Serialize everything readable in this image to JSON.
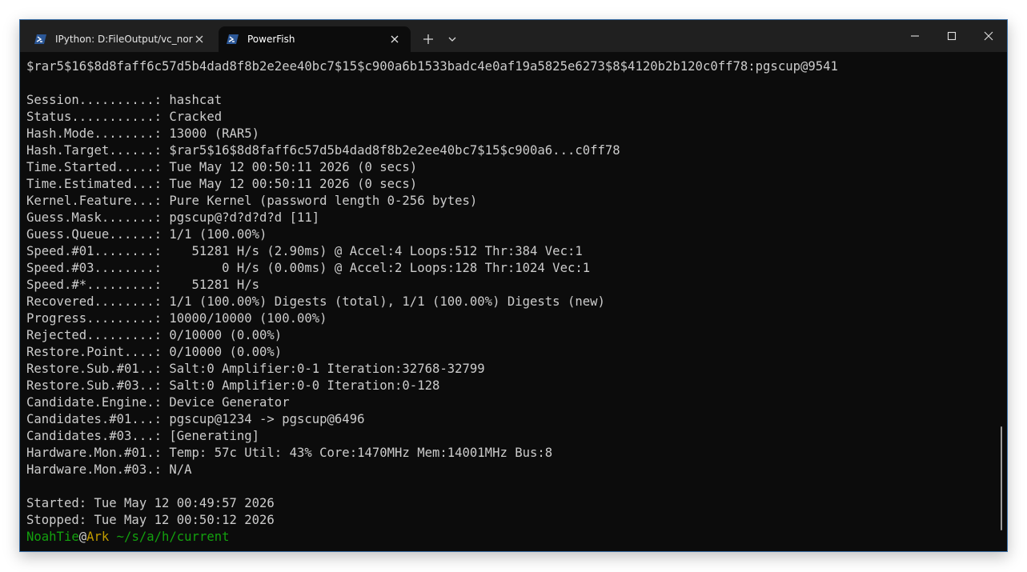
{
  "tabs": [
    {
      "label": "IPython: D:FileOutput/vc_norm",
      "icon": "powershell-icon",
      "active": false
    },
    {
      "label": "PowerFish",
      "icon": "powershell-icon",
      "active": true
    }
  ],
  "controls": {
    "new_tab_icon": "plus-icon",
    "dropdown_icon": "chevron-down-icon",
    "minimize_icon": "minimize-icon",
    "maximize_icon": "maximize-icon",
    "close_icon": "close-icon"
  },
  "terminal": {
    "lines": [
      "$rar5$16$8d8faff6c57d5b4dad8f8b2e2ee40bc7$15$c900a6b1533badc4e0af19a5825e6273$8$4120b2b120c0ff78:pgscup@9541",
      "",
      "Session..........: hashcat",
      "Status...........: Cracked",
      "Hash.Mode........: 13000 (RAR5)",
      "Hash.Target......: $rar5$16$8d8faff6c57d5b4dad8f8b2e2ee40bc7$15$c900a6...c0ff78",
      "Time.Started.....: Tue May 12 00:50:11 2026 (0 secs)",
      "Time.Estimated...: Tue May 12 00:50:11 2026 (0 secs)",
      "Kernel.Feature...: Pure Kernel (password length 0-256 bytes)",
      "Guess.Mask.......: pgscup@?d?d?d?d [11]",
      "Guess.Queue......: 1/1 (100.00%)",
      "Speed.#01........:    51281 H/s (2.90ms) @ Accel:4 Loops:512 Thr:384 Vec:1",
      "Speed.#03........:        0 H/s (0.00ms) @ Accel:2 Loops:128 Thr:1024 Vec:1",
      "Speed.#*.........:    51281 H/s",
      "Recovered........: 1/1 (100.00%) Digests (total), 1/1 (100.00%) Digests (new)",
      "Progress.........: 10000/10000 (100.00%)",
      "Rejected.........: 0/10000 (0.00%)",
      "Restore.Point....: 0/10000 (0.00%)",
      "Restore.Sub.#01..: Salt:0 Amplifier:0-1 Iteration:32768-32799",
      "Restore.Sub.#03..: Salt:0 Amplifier:0-0 Iteration:0-128",
      "Candidate.Engine.: Device Generator",
      "Candidates.#01...: pgscup@1234 -> pgscup@6496",
      "Candidates.#03...: [Generating]",
      "Hardware.Mon.#01.: Temp: 57c Util: 43% Core:1470MHz Mem:14001MHz Bus:8",
      "Hardware.Mon.#03.: N/A",
      "",
      "Started: Tue May 12 00:49:57 2026",
      "Stopped: Tue May 12 00:50:12 2026"
    ],
    "prompt": {
      "user": "NoahTie",
      "at": "@",
      "host": "Ark",
      "path": " ~/s/a/h/current"
    }
  },
  "colors": {
    "background": "#0c0c0c",
    "foreground": "#cccccc",
    "prompt_user": "#13a10e",
    "prompt_host": "#c19c00",
    "titlebar": "#202020"
  }
}
